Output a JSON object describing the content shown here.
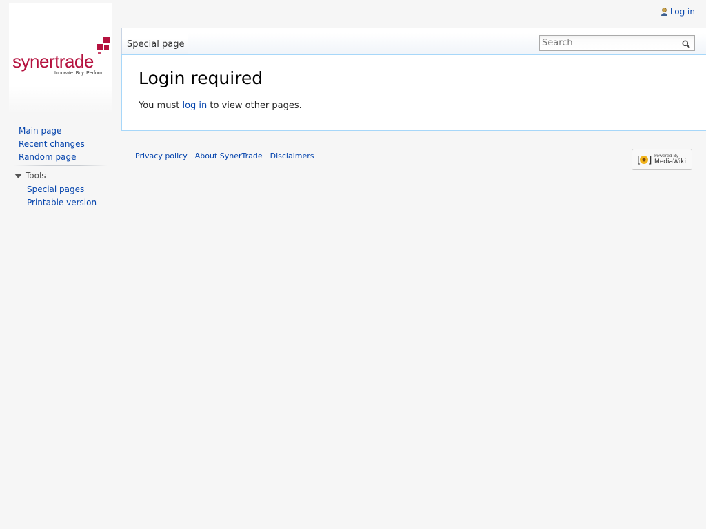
{
  "logo": {
    "brand": "synertrade",
    "tagline": "Innovate. Buy. Perform."
  },
  "personal": {
    "login_label": "Log in",
    "icon": "user-icon"
  },
  "tabs": [
    {
      "label": "Special page"
    }
  ],
  "search": {
    "placeholder": "Search",
    "icon": "search-icon"
  },
  "main": {
    "title": "Login required",
    "message_prefix": "You must ",
    "message_link": "log in",
    "message_suffix": " to view other pages."
  },
  "sidebar": {
    "navigation": [
      {
        "label": "Main page"
      },
      {
        "label": "Recent changes"
      },
      {
        "label": "Random page"
      }
    ],
    "tools": {
      "heading": "Tools",
      "items": [
        {
          "label": "Special pages"
        },
        {
          "label": "Printable version"
        }
      ]
    }
  },
  "footer": {
    "links": [
      {
        "label": "Privacy policy"
      },
      {
        "label": "About SynerTrade"
      },
      {
        "label": "Disclaimers"
      }
    ],
    "powered_by": {
      "line1": "Powered By",
      "line2": "MediaWiki"
    }
  },
  "colors": {
    "link": "#0645ad",
    "brand_red": "#b5123f",
    "content_border": "#a7d7f9",
    "sidebar_bg": "#f6f6f6"
  }
}
